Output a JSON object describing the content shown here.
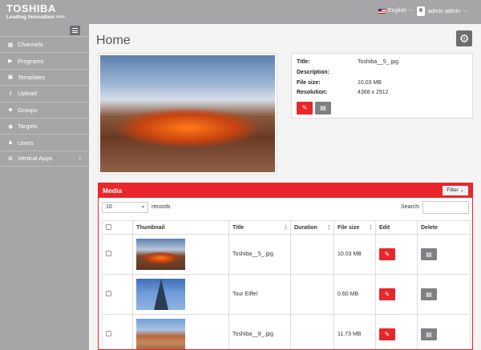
{
  "header": {
    "brand": "TOSHIBA",
    "tagline": "Leading Innovation >>>",
    "language": "English",
    "user": "admin admin"
  },
  "sidebar": {
    "items": [
      {
        "label": "Channels",
        "icon": "grid-icon"
      },
      {
        "label": "Programs",
        "icon": "play-circle-icon"
      },
      {
        "label": "Templates",
        "icon": "image-icon"
      },
      {
        "label": "Upload",
        "icon": "upload-icon"
      },
      {
        "label": "Groups",
        "icon": "users-group-icon"
      },
      {
        "label": "Targets",
        "icon": "target-icon"
      },
      {
        "label": "Users",
        "icon": "user-icon"
      },
      {
        "label": "Vertical Apps",
        "icon": "plus-box-icon"
      }
    ]
  },
  "main": {
    "title": "Home",
    "info": {
      "title_label": "Title:",
      "title_value": "Toshiba__5_.jpg",
      "description_label": "Description:",
      "description_value": "",
      "filesize_label": "File size:",
      "filesize_value": "10.03 MB",
      "resolution_label": "Resolution:",
      "resolution_value": "4368 x 2912"
    },
    "media": {
      "heading": "Media",
      "filter_label": "Filter",
      "page_length": "10",
      "records_label": "records",
      "search_label": "Search:",
      "columns": [
        "Thumbnail",
        "Title",
        "Duration",
        "File size",
        "Edit",
        "Delete"
      ],
      "rows": [
        {
          "title": "Toshiba__5_.jpg",
          "duration": "",
          "filesize": "10.03 MB"
        },
        {
          "title": "Tour Eiffel",
          "duration": "",
          "filesize": "0.60 MB"
        },
        {
          "title": "Toshiba__8_.jpg",
          "duration": "",
          "filesize": "11.73 MB"
        }
      ]
    }
  },
  "colors": {
    "accent_red": "#e8262b",
    "chrome_gray": "#a6a6a9",
    "button_gray": "#808084"
  }
}
